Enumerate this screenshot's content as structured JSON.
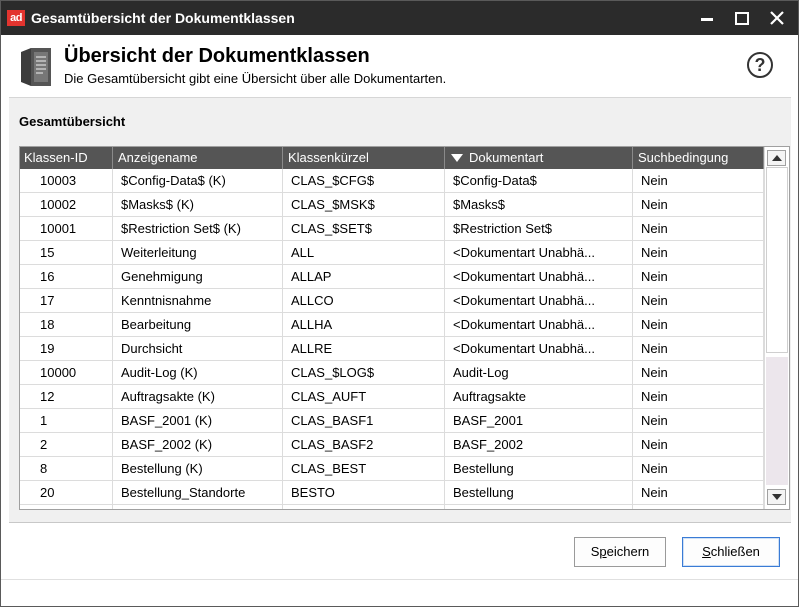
{
  "window": {
    "title": "Gesamtübersicht der Dokumentklassen",
    "logo_text": "ad"
  },
  "header": {
    "title": "Übersicht der Dokumentklassen",
    "subtitle": "Die Gesamtübersicht gibt eine Übersicht über alle Dokumentarten.",
    "help_glyph": "?"
  },
  "section": {
    "title": "Gesamtübersicht"
  },
  "table": {
    "columns": [
      "Klassen-ID",
      "Anzeigename",
      "Klassenkürzel",
      "Dokumentart",
      "Suchbedingung"
    ],
    "sorted_column": "Dokumentart",
    "rows": [
      [
        "10003",
        "$Config-Data$ (K)",
        "CLAS_$CFG$",
        "$Config-Data$",
        "Nein"
      ],
      [
        "10002",
        "$Masks$ (K)",
        "CLAS_$MSK$",
        "$Masks$",
        "Nein"
      ],
      [
        "10001",
        "$Restriction Set$ (K)",
        "CLAS_$SET$",
        "$Restriction Set$",
        "Nein"
      ],
      [
        "15",
        "Weiterleitung",
        "ALL",
        "<Dokumentart Unabhä...",
        "Nein"
      ],
      [
        "16",
        "Genehmigung",
        "ALLAP",
        "<Dokumentart Unabhä...",
        "Nein"
      ],
      [
        "17",
        "Kenntnisnahme",
        "ALLCO",
        "<Dokumentart Unabhä...",
        "Nein"
      ],
      [
        "18",
        "Bearbeitung",
        "ALLHA",
        "<Dokumentart Unabhä...",
        "Nein"
      ],
      [
        "19",
        "Durchsicht",
        "ALLRE",
        "<Dokumentart Unabhä...",
        "Nein"
      ],
      [
        "10000",
        "Audit-Log (K)",
        "CLAS_$LOG$",
        "Audit-Log",
        "Nein"
      ],
      [
        "12",
        "Auftragsakte (K)",
        "CLAS_AUFT",
        "Auftragsakte",
        "Nein"
      ],
      [
        "1",
        "BASF_2001 (K)",
        "CLAS_BASF1",
        "BASF_2001",
        "Nein"
      ],
      [
        "2",
        "BASF_2002 (K)",
        "CLAS_BASF2",
        "BASF_2002",
        "Nein"
      ],
      [
        "8",
        "Bestellung (K)",
        "CLAS_BEST",
        "Bestellung",
        "Nein"
      ],
      [
        "20",
        "Bestellung_Standorte",
        "BESTO",
        "Bestellung",
        "Nein"
      ],
      [
        "",
        "",
        "",
        "",
        ""
      ]
    ]
  },
  "buttons": {
    "save_prefix": "S",
    "save_mnemonic": "p",
    "save_rest": "eichern",
    "close_mnemonic": "S",
    "close_rest": "chließen"
  },
  "colors": {
    "titlebar": "#2b2b2b",
    "grid_header": "#555555",
    "logo": "#e3342f",
    "focus_border": "#3a7bd5"
  }
}
